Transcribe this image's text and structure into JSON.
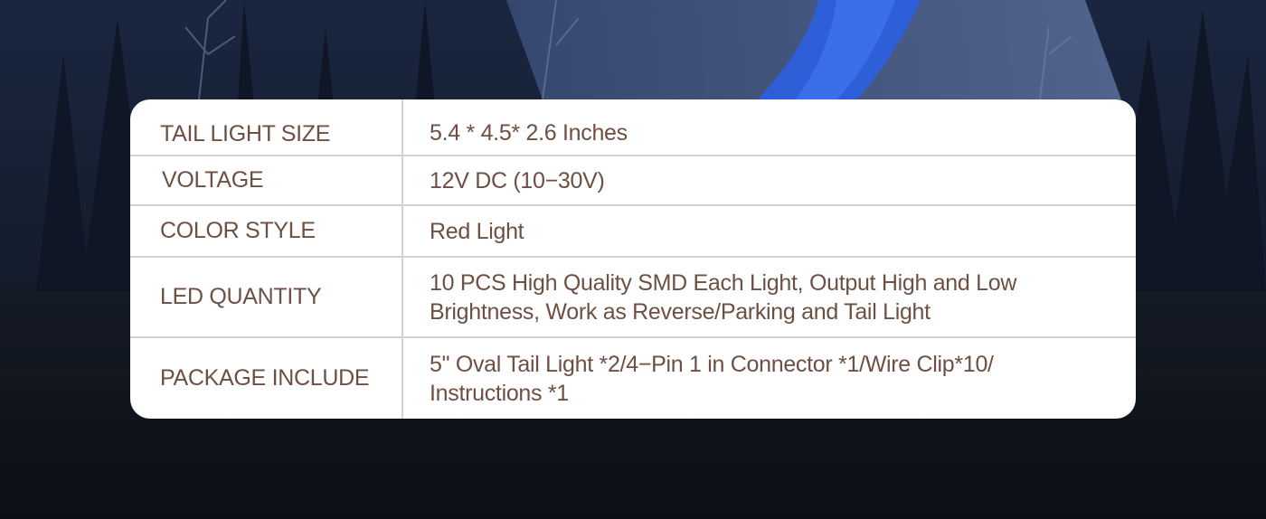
{
  "spec_table": {
    "rows": [
      {
        "label": "TAIL LIGHT SIZE",
        "value": "5.4 * 4.5* 2.6 Inches"
      },
      {
        "label": "VOLTAGE",
        "value": "12V DC (10−30V)"
      },
      {
        "label": "COLOR STYLE",
        "value": "Red Light"
      },
      {
        "label": "LED QUANTITY",
        "value": "10 PCS High Quality SMD Each Light, Output High and Low Brightness, Work as Reverse/Parking and Tail Light"
      },
      {
        "label": "PACKAGE INCLUDE",
        "value": "5\" Oval Tail Light *2/4−Pin 1 in Connector *1/Wire Clip*10/ Instructions *1"
      }
    ]
  },
  "colors": {
    "text": "#6e4f43",
    "divider": "#d2d2d2",
    "card": "#ffffff",
    "lower_band": "#0d1219"
  }
}
